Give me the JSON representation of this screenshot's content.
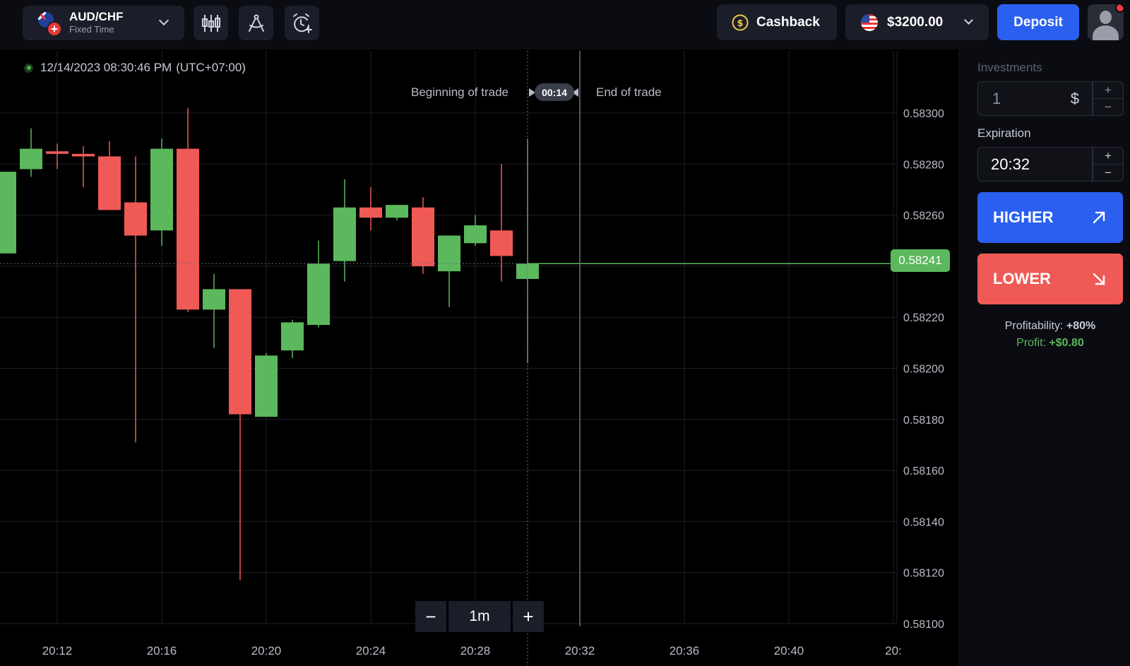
{
  "header": {
    "pair_name": "AUD/CHF",
    "pair_mode": "Fixed Time",
    "cashback_label": "Cashback",
    "balance": "$3200.00",
    "deposit_label": "Deposit"
  },
  "chart": {
    "timestamp": "12/14/2023 08:30:46 PM",
    "timezone": "(UTC+07:00)",
    "beginning_label": "Beginning of trade",
    "end_label": "End of trade",
    "countdown": "00:14",
    "current_price": "0.58241",
    "timeframe": "1m"
  },
  "sidebar": {
    "investments_label": "Investments",
    "investment_value": "1",
    "currency_symbol": "$",
    "expiration_label": "Expiration",
    "expiration_value": "20:32",
    "higher_label": "HIGHER",
    "lower_label": "LOWER",
    "profitability_label": "Profitability:",
    "profitability_value": "+80%",
    "profit_label": "Profit:",
    "profit_value": "+$0.80"
  },
  "colors": {
    "up": "#5cb85c",
    "down": "#ef5a56",
    "higher_button": "#2b5ff0",
    "lower_button": "#ef5a56",
    "deposit_button": "#2b5ff0"
  },
  "chart_data": {
    "type": "candlestick",
    "y_ticks": [
      "0.58300",
      "0.58280",
      "0.58260",
      "0.58240",
      "0.58220",
      "0.58200",
      "0.58180",
      "0.58160",
      "0.58140",
      "0.58120",
      "0.58100"
    ],
    "x_ticks": [
      "20:12",
      "20:16",
      "20:20",
      "20:24",
      "20:28",
      "20:32",
      "20:36",
      "20:40",
      "20:"
    ],
    "ylim": [
      0.581,
      0.5831
    ],
    "candles": [
      {
        "t": "20:10",
        "o": 0.58245,
        "h": 0.58276,
        "l": 0.58253,
        "c": 0.58277
      },
      {
        "t": "20:11",
        "o": 0.58278,
        "h": 0.58294,
        "l": 0.58275,
        "c": 0.58286
      },
      {
        "t": "20:12",
        "o": 0.58285,
        "h": 0.58288,
        "l": 0.58278,
        "c": 0.58284
      },
      {
        "t": "20:13",
        "o": 0.58284,
        "h": 0.58287,
        "l": 0.58271,
        "c": 0.58283
      },
      {
        "t": "20:14",
        "o": 0.58283,
        "h": 0.58289,
        "l": 0.58262,
        "c": 0.58262
      },
      {
        "t": "20:15",
        "o": 0.58265,
        "h": 0.58283,
        "l": 0.58171,
        "c": 0.58252
      },
      {
        "t": "20:16",
        "o": 0.58254,
        "h": 0.5829,
        "l": 0.58248,
        "c": 0.58286
      },
      {
        "t": "20:17",
        "o": 0.58286,
        "h": 0.58302,
        "l": 0.58222,
        "c": 0.58223
      },
      {
        "t": "20:18",
        "o": 0.58223,
        "h": 0.58237,
        "l": 0.58208,
        "c": 0.58231
      },
      {
        "t": "20:19",
        "o": 0.58231,
        "h": 0.58231,
        "l": 0.58117,
        "c": 0.58182
      },
      {
        "t": "20:20",
        "o": 0.58181,
        "h": 0.58206,
        "l": 0.58181,
        "c": 0.58205
      },
      {
        "t": "20:21",
        "o": 0.58207,
        "h": 0.58219,
        "l": 0.58204,
        "c": 0.58218
      },
      {
        "t": "20:22",
        "o": 0.58217,
        "h": 0.5825,
        "l": 0.58216,
        "c": 0.58241
      },
      {
        "t": "20:23",
        "o": 0.58242,
        "h": 0.58274,
        "l": 0.58234,
        "c": 0.58263
      },
      {
        "t": "20:24",
        "o": 0.58263,
        "h": 0.58271,
        "l": 0.58254,
        "c": 0.58259
      },
      {
        "t": "20:25",
        "o": 0.58259,
        "h": 0.58264,
        "l": 0.58258,
        "c": 0.58264
      },
      {
        "t": "20:26",
        "o": 0.58263,
        "h": 0.58267,
        "l": 0.58237,
        "c": 0.5824
      },
      {
        "t": "20:27",
        "o": 0.58238,
        "h": 0.58251,
        "l": 0.58224,
        "c": 0.58252
      },
      {
        "t": "20:28",
        "o": 0.58249,
        "h": 0.5826,
        "l": 0.58248,
        "c": 0.58256
      },
      {
        "t": "20:29",
        "o": 0.58254,
        "h": 0.5828,
        "l": 0.58234,
        "c": 0.58244
      },
      {
        "t": "20:30",
        "o": 0.58235,
        "h": 0.5829,
        "l": 0.58202,
        "c": 0.58241
      }
    ]
  }
}
